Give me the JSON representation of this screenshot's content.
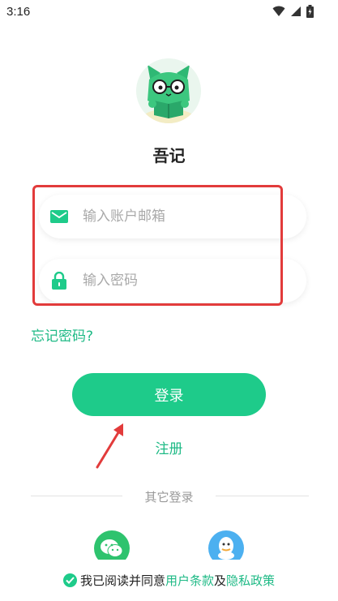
{
  "status_bar": {
    "time": "3:16"
  },
  "app": {
    "name": "吾记"
  },
  "login_form": {
    "email_placeholder": "输入账户邮箱",
    "password_placeholder": "输入密码",
    "forgot_password": "忘记密码?",
    "login_button": "登录",
    "register_link": "注册"
  },
  "other_login": {
    "divider_text": "其它登录",
    "providers": [
      {
        "icon": "wechat-icon",
        "color": "#2ec36e"
      },
      {
        "icon": "qq-icon",
        "color": "#4cb0f0"
      }
    ]
  },
  "agreement": {
    "prefix": "我已阅读并同意",
    "terms": "用户条款",
    "and": "及",
    "privacy": "隐私政策"
  },
  "colors": {
    "accent": "#1ecb8a",
    "link": "#1fba86",
    "highlight": "#e23b3b"
  }
}
